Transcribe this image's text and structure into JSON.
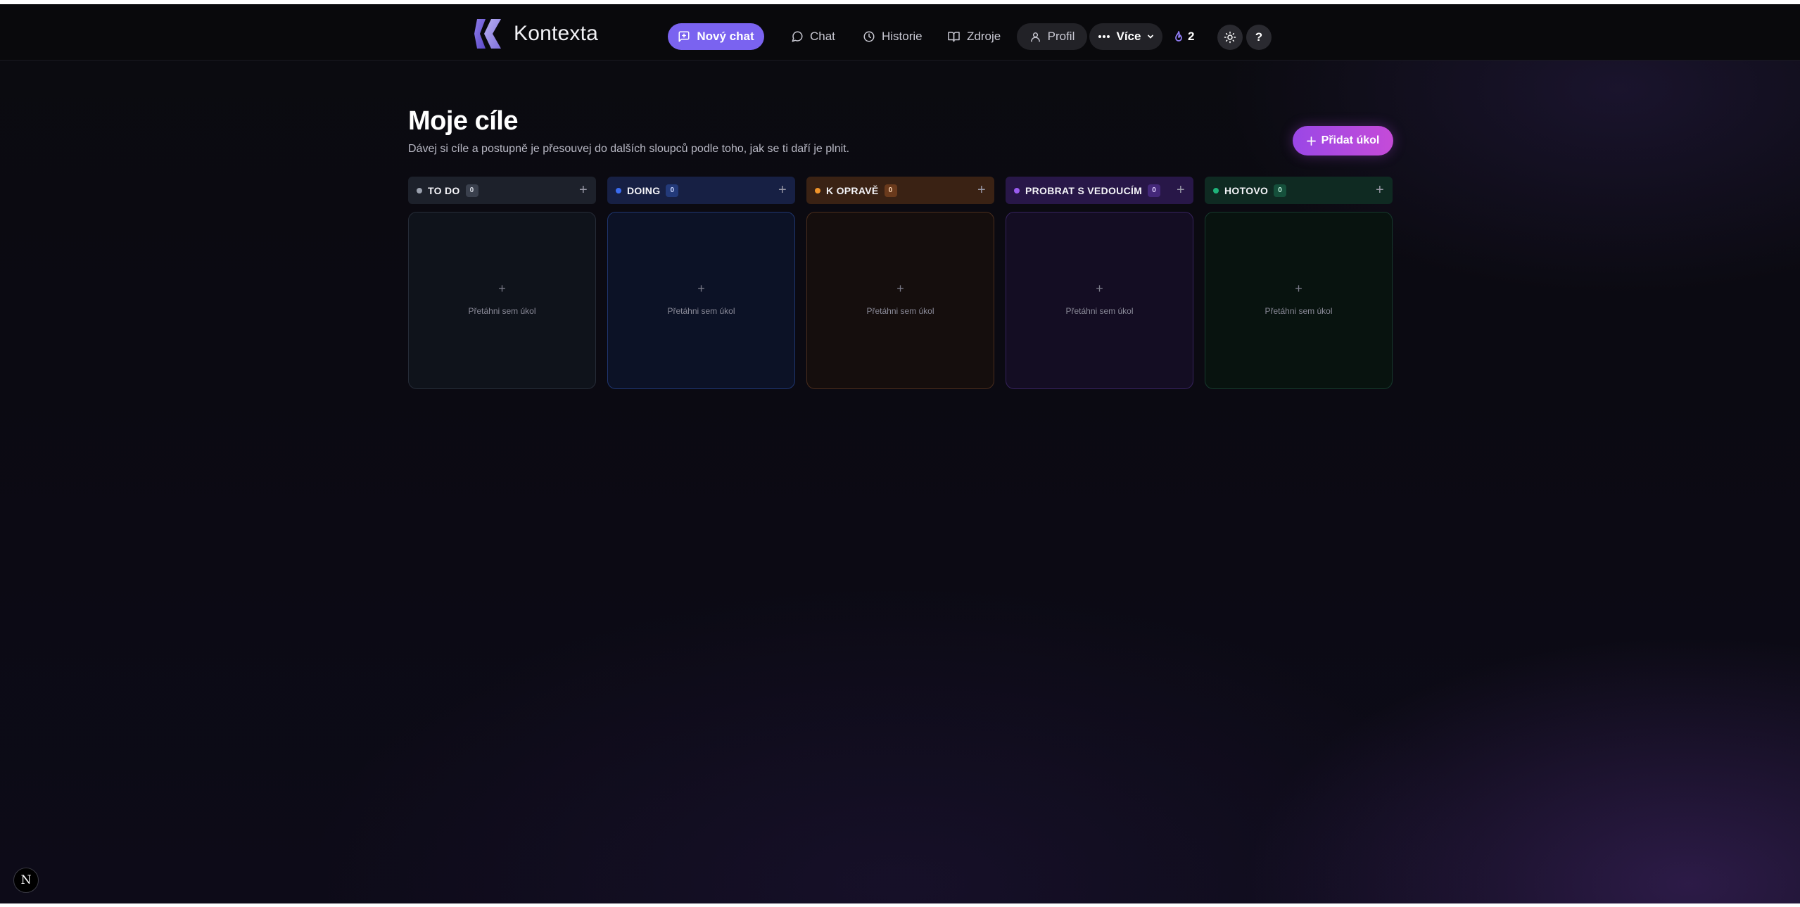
{
  "header": {
    "brand": "Kontexta",
    "nav": {
      "new_chat": "Nový chat",
      "chat": "Chat",
      "history": "Historie",
      "sources": "Zdroje",
      "profile": "Profil",
      "more": "Více"
    },
    "streak_count": "2",
    "help": "?"
  },
  "page": {
    "title": "Moje cíle",
    "subtitle": "Dávej si cíle a postupně je přesouvej do dalších sloupců podle toho, jak se ti daří je plnit.",
    "add_task": "Přidat úkol"
  },
  "columns": [
    {
      "label": "TO DO",
      "count": "0",
      "color": "#9aa0ad",
      "placeholder": "Přetáhni sem úkol"
    },
    {
      "label": "DOING",
      "count": "0",
      "color": "#3b6cf0",
      "placeholder": "Přetáhni sem úkol"
    },
    {
      "label": "K OPRAVĚ",
      "count": "0",
      "color": "#f0942a",
      "placeholder": "Přetáhni sem úkol"
    },
    {
      "label": "PROBRAT S VEDOUCÍM",
      "count": "0",
      "color": "#9a5cf0",
      "placeholder": "Přetáhni sem úkol"
    },
    {
      "label": "HOTOVO",
      "count": "0",
      "color": "#1fb37a",
      "placeholder": "Přetáhni sem úkol"
    }
  ],
  "badge": "N"
}
